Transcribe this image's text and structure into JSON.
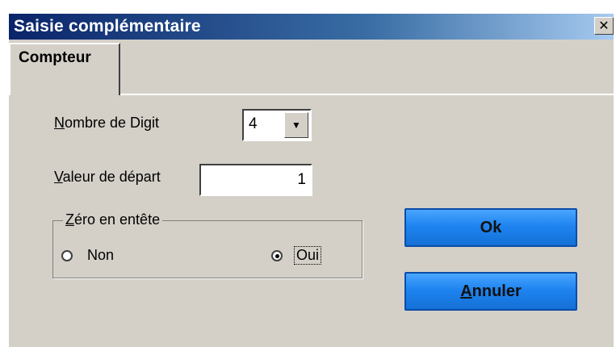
{
  "window": {
    "title": "Saisie complémentaire",
    "close_glyph": "✕"
  },
  "tabs": [
    {
      "label": "Compteur",
      "active": true
    }
  ],
  "fields": {
    "digits": {
      "label_accel": "N",
      "label_rest": "ombre de Digit",
      "value": "4"
    },
    "start": {
      "label_accel": "V",
      "label_rest": "aleur de départ",
      "value": "1"
    }
  },
  "zero_group": {
    "legend_accel": "Z",
    "legend_rest": "éro en entête",
    "options": [
      {
        "label": "Non",
        "checked": false
      },
      {
        "label": "Oui",
        "checked": true
      }
    ]
  },
  "buttons": {
    "ok": {
      "label": "Ok"
    },
    "cancel": {
      "label_accel": "A",
      "label_rest": "nnuler"
    }
  },
  "colors": {
    "titlebar_start": "#0a246a",
    "dialog_bg": "#d4d0c8",
    "button_blue": "#1e84f0"
  },
  "icons": {
    "close": "close-icon",
    "dropdown": "chevron-down-icon"
  }
}
